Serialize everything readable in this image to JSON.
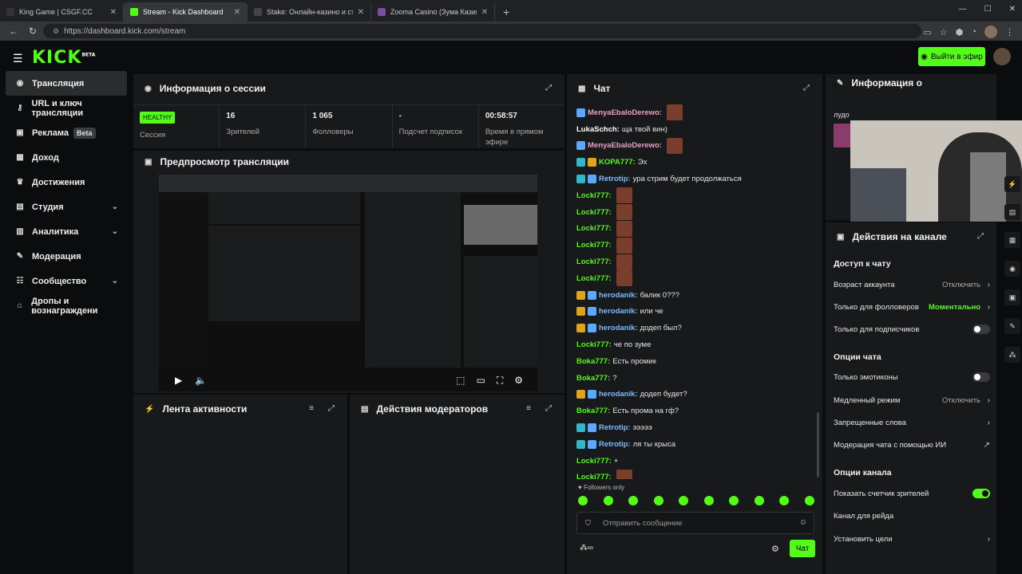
{
  "browser": {
    "tabs": [
      {
        "title": "King Game | CSGF.CC",
        "color": "#333333"
      },
      {
        "title": "Stream - Kick Dashboard",
        "color": "#53fc18"
      },
      {
        "title": "Stake: Онлайн-казино и ставки н",
        "color": "#444444"
      },
      {
        "title": "Zooma Casino (Зума Казино) оф",
        "color": "#7a4ea3"
      }
    ],
    "url": "https://dashboard.kick.com/stream"
  },
  "header": {
    "logo": "KICK",
    "logo_tag": "BETA",
    "go_live": "Выйти в эфир"
  },
  "sidebar": {
    "items": [
      {
        "label": "Трансляция",
        "icon": "broadcast-icon"
      },
      {
        "label": "URL и ключ трансляции",
        "icon": "key-icon"
      },
      {
        "label": "Реклама",
        "icon": "ads-icon",
        "badge": "Beta"
      },
      {
        "label": "Доход",
        "icon": "income-icon"
      },
      {
        "label": "Достижения",
        "icon": "trophy-icon"
      },
      {
        "label": "Студия",
        "icon": "studio-icon",
        "chevron": true
      },
      {
        "label": "Аналитика",
        "icon": "analytics-icon",
        "chevron": true
      },
      {
        "label": "Модерация",
        "icon": "wrench-icon"
      },
      {
        "label": "Сообщество",
        "icon": "community-icon",
        "chevron": true
      },
      {
        "label": "Дропы и вознаграждени",
        "icon": "gift-icon"
      }
    ]
  },
  "session": {
    "title": "Информация о сессии",
    "health": "HEALTHY",
    "stats": [
      {
        "value": "",
        "label": "Сессия"
      },
      {
        "value": "16",
        "label": "Зрителей"
      },
      {
        "value": "1 065",
        "label": "Фолловеры"
      },
      {
        "value": "-",
        "label": "Подсчет подписок"
      },
      {
        "value": "00:58:57",
        "label": "Время в прямом эфире"
      }
    ]
  },
  "preview": {
    "title": "Предпросмотр трансляции"
  },
  "activity": {
    "title": "Лента активности"
  },
  "modactions": {
    "title": "Действия модераторов"
  },
  "chat": {
    "title": "Чат",
    "messages": [
      {
        "user": "MenyaEbaloDerewo:",
        "text": "",
        "color": "#e8a1c6",
        "badges": [
          "#5aa9ff"
        ],
        "emote": true
      },
      {
        "user": "LukaSchch:",
        "text": "ща твой вин)",
        "color": "#ffffff",
        "badges": []
      },
      {
        "user": "MenyaEbaloDerewo:",
        "text": "",
        "color": "#e8a1c6",
        "badges": [
          "#5aa9ff"
        ],
        "emote": true
      },
      {
        "user": "KOPA777:",
        "text": "Эх",
        "color": "#53fc18",
        "badges": [
          "#2fb8c9",
          "#e0a31a"
        ]
      },
      {
        "user": "Retrotip:",
        "text": "ура стрим будет продолжаться",
        "color": "#7dbbff",
        "badges": [
          "#2fb8c9",
          "#5aa9ff"
        ]
      },
      {
        "user": "Locki777:",
        "text": "",
        "color": "#53fc18",
        "badges": [],
        "emote": true
      },
      {
        "user": "Locki777:",
        "text": "",
        "color": "#53fc18",
        "badges": [],
        "emote": true
      },
      {
        "user": "Locki777:",
        "text": "",
        "color": "#53fc18",
        "badges": [],
        "emote": true
      },
      {
        "user": "Locki777:",
        "text": "",
        "color": "#53fc18",
        "badges": [],
        "emote": true
      },
      {
        "user": "Locki777:",
        "text": "",
        "color": "#53fc18",
        "badges": [],
        "emote": true
      },
      {
        "user": "Locki777:",
        "text": "",
        "color": "#53fc18",
        "badges": [],
        "emote": true
      },
      {
        "user": "herodanik:",
        "text": "балик 0???",
        "color": "#7dbbff",
        "badges": [
          "#e0a31a",
          "#5aa9ff"
        ]
      },
      {
        "user": "herodanik:",
        "text": "или че",
        "color": "#7dbbff",
        "badges": [
          "#e0a31a",
          "#5aa9ff"
        ]
      },
      {
        "user": "herodanik:",
        "text": "додеп был?",
        "color": "#7dbbff",
        "badges": [
          "#e0a31a",
          "#5aa9ff"
        ]
      },
      {
        "user": "Locki777:",
        "text": "че по зуме",
        "color": "#53fc18",
        "badges": []
      },
      {
        "user": "Boka777:",
        "text": "Есть промик",
        "color": "#53fc18",
        "badges": []
      },
      {
        "user": "Boka777:",
        "text": "?",
        "color": "#53fc18",
        "badges": []
      },
      {
        "user": "herodanik:",
        "text": "додеп будет?",
        "color": "#7dbbff",
        "badges": [
          "#e0a31a",
          "#5aa9ff"
        ]
      },
      {
        "user": "Boka777:",
        "text": "Есть прома на гф?",
        "color": "#53fc18",
        "badges": []
      },
      {
        "user": "Retrotip:",
        "text": "эээээ",
        "color": "#7dbbff",
        "badges": [
          "#2fb8c9",
          "#5aa9ff"
        ]
      },
      {
        "user": "Retrotip:",
        "text": "ля ты крыса",
        "color": "#7dbbff",
        "badges": [
          "#2fb8c9",
          "#5aa9ff"
        ]
      },
      {
        "user": "Locki777:",
        "text": "+",
        "color": "#53fc18",
        "badges": []
      },
      {
        "user": "Locki777:",
        "text": "",
        "color": "#53fc18",
        "badges": [],
        "emote": true
      }
    ],
    "followers_only": "♥ Followers only",
    "placeholder": "Отправить сообщение",
    "send": "Чат"
  },
  "channelinfo": {
    "title": "Информация о",
    "snippet": "лудо"
  },
  "actions": {
    "title": "Действия на канале",
    "chat_access": "Доступ к чату",
    "account_age": "Возраст аккаунта",
    "account_age_val": "Отключить",
    "followers_only": "Только для фолловеров",
    "followers_only_val": "Моментально",
    "subs_only": "Только для подписчиков",
    "chat_options": "Опции чата",
    "emotes_only": "Только эмотиконы",
    "slow_mode": "Медленный режим",
    "slow_mode_val": "Отключить",
    "banned_words": "Запрещенные слова",
    "ai_mod": "Модерация чата с помощью ИИ",
    "channel_options": "Опции канала",
    "show_viewers": "Показать счетчик зрителей",
    "raid_channel": "Канал для рейда",
    "set_goals": "Установить цели"
  },
  "colors": {
    "accent": "#53fc18",
    "panel": "#18191b",
    "bg": "#0b0c0d"
  }
}
